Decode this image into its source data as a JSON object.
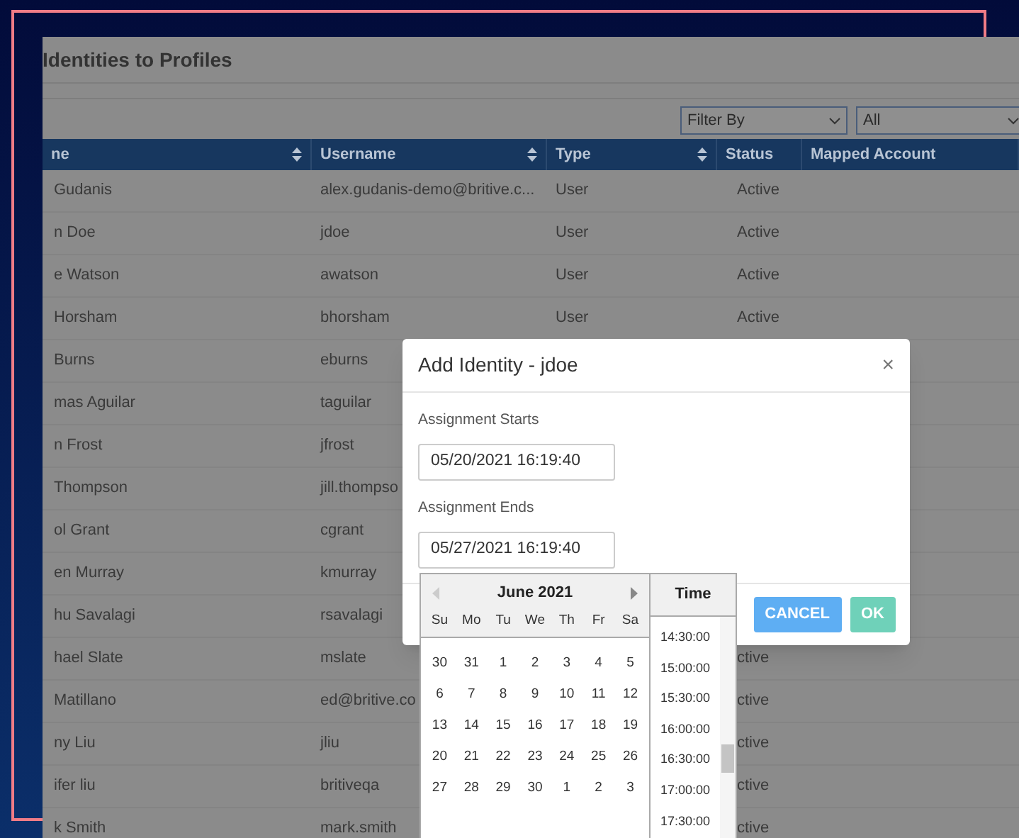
{
  "page": {
    "title": "Identities to Profiles"
  },
  "filters": [
    {
      "value": "Filter By"
    },
    {
      "value": "All"
    }
  ],
  "table": {
    "columns": [
      {
        "label": "ne",
        "sortable": true
      },
      {
        "label": "Username",
        "sortable": true
      },
      {
        "label": "Type",
        "sortable": true
      },
      {
        "label": "Status",
        "sortable": false
      },
      {
        "label": "Mapped Account",
        "sortable": false
      }
    ],
    "rows": [
      {
        "name": "Gudanis",
        "username": "alex.gudanis-demo@britive.c...",
        "type": "User",
        "status": "Active"
      },
      {
        "name": "n Doe",
        "username": "jdoe",
        "type": "User",
        "status": "Active"
      },
      {
        "name": "e Watson",
        "username": "awatson",
        "type": "User",
        "status": "Active"
      },
      {
        "name": "Horsham",
        "username": "bhorsham",
        "type": "User",
        "status": "Active"
      },
      {
        "name": "Burns",
        "username": "eburns"
      },
      {
        "name": "mas Aguilar",
        "username": "taguilar"
      },
      {
        "name": "n Frost",
        "username": "jfrost"
      },
      {
        "name": "Thompson",
        "username": "jill.thompso"
      },
      {
        "name": "ol Grant",
        "username": "cgrant"
      },
      {
        "name": "en Murray",
        "username": "kmurray"
      },
      {
        "name": "hu Savalagi",
        "username": "rsavalagi"
      },
      {
        "name": "hael Slate",
        "username": "mslate",
        "status": "ctive"
      },
      {
        "name": "Matillano",
        "username": "ed@britive.co",
        "status": "ctive"
      },
      {
        "name": "ny Liu",
        "username": "jliu",
        "status": "ctive"
      },
      {
        "name": "ifer liu",
        "username": "britiveqa",
        "status": "ctive"
      },
      {
        "name": "k Smith",
        "username": "mark.smith",
        "status": "ctive"
      }
    ]
  },
  "dialog": {
    "title": "Add Identity - jdoe",
    "close": "×",
    "fields": [
      {
        "label": "Assignment Starts",
        "value": "05/20/2021 16:19:40"
      },
      {
        "label": "Assignment Ends",
        "value": "05/27/2021 16:19:40"
      }
    ],
    "buttons": [
      {
        "label": "CANCEL",
        "kind": "secondary"
      },
      {
        "label": "OK",
        "kind": "primary"
      }
    ]
  },
  "datepicker": {
    "month": "June 2021",
    "time_heading": "Time",
    "weekdays": [
      "Su",
      "Mo",
      "Tu",
      "We",
      "Th",
      "Fr",
      "Sa"
    ],
    "weeks": [
      [
        "30",
        "31",
        "1",
        "2",
        "3",
        "4",
        "5"
      ],
      [
        "6",
        "7",
        "8",
        "9",
        "10",
        "11",
        "12"
      ],
      [
        "13",
        "14",
        "15",
        "16",
        "17",
        "18",
        "19"
      ],
      [
        "20",
        "21",
        "22",
        "23",
        "24",
        "25",
        "26"
      ],
      [
        "27",
        "28",
        "29",
        "30",
        "1",
        "2",
        "3"
      ]
    ],
    "times": [
      "14:30:00",
      "15:00:00",
      "15:30:00",
      "16:00:00",
      "16:30:00",
      "17:00:00",
      "17:30:00"
    ]
  }
}
